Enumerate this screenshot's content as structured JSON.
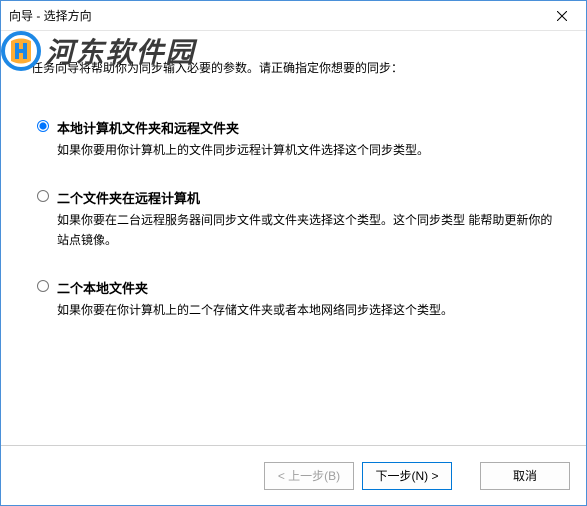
{
  "titlebar": {
    "title": "向导 - 选择方向"
  },
  "watermark": {
    "text": "河东软件园"
  },
  "intro": "任务向导将帮助你为同步输入必要的参数。请正确指定你想要的同步：",
  "options": [
    {
      "title": "本地计算机文件夹和远程文件夹",
      "desc": "如果你要用你计算机上的文件同步远程计算机文件选择这个同步类型。",
      "selected": true
    },
    {
      "title": "二个文件夹在远程计算机",
      "desc": "如果你要在二台远程服务器间同步文件或文件夹选择这个类型。这个同步类型 能帮助更新你的站点镜像。",
      "selected": false
    },
    {
      "title": "二个本地文件夹",
      "desc": "如果你要在你计算机上的二个存储文件夹或者本地网络同步选择这个类型。",
      "selected": false
    }
  ],
  "footer": {
    "back": "< 上一步(B)",
    "next": "下一步(N) >",
    "cancel": "取消"
  }
}
